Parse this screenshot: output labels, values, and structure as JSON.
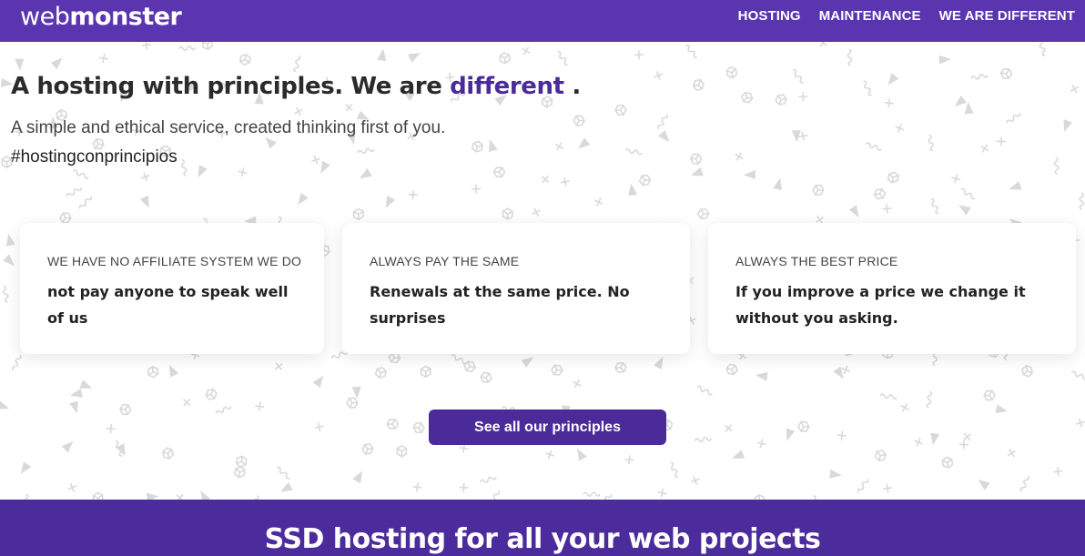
{
  "header": {
    "logo_part1": "web",
    "logo_part2": "monster",
    "nav": [
      {
        "label": "HOSTING"
      },
      {
        "label": "MAINTENANCE"
      },
      {
        "label": "WE ARE DIFFERENT"
      }
    ]
  },
  "hero": {
    "title_prefix": "A hosting with principles. We are ",
    "title_accent": "different",
    "title_suffix": " .",
    "subtitle": "A simple and ethical service, created thinking first of you.",
    "hashtag": "#hostingconprincipios"
  },
  "cards": [
    {
      "kicker": "WE HAVE NO AFFILIATE SYSTEM WE DO",
      "body": "not pay anyone to speak well of us"
    },
    {
      "kicker": "ALWAYS PAY THE SAME",
      "body": "Renewals at the same price. No surprises"
    },
    {
      "kicker": "ALWAYS THE BEST PRICE",
      "body": "If you improve a price we change it without you asking."
    }
  ],
  "cta": {
    "label": "See all our principles"
  },
  "band": {
    "title": "SSD hosting for all your web projects"
  },
  "colors": {
    "brand_purple": "#5b35b0",
    "accent_purple": "#4b2a9a",
    "pattern_gray": "#d9d9d9"
  },
  "icons": [
    "triangle-icon",
    "plus-icon",
    "squiggle-icon",
    "cube-icon"
  ]
}
